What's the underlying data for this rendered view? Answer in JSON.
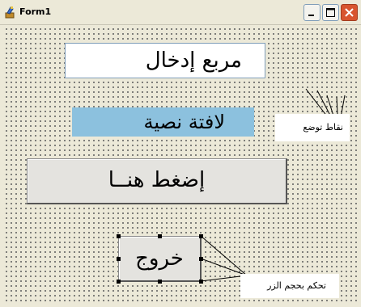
{
  "window": {
    "title": "Form1",
    "icon": "app-icon",
    "controls": [
      "minimize-icon",
      "maximize-icon",
      "close-icon"
    ]
  },
  "form": {
    "textbox": {
      "text": "مربع إدخال"
    },
    "label": {
      "text": "لافتة نصية",
      "background_color": "#8cc1de"
    },
    "press_button": {
      "label": "إضغط هنــا"
    },
    "exit_button": {
      "label": "خروج"
    }
  },
  "annotations": {
    "position_points": "نقاط توضع",
    "button_size_control": "تحكم بحجم الزر"
  }
}
